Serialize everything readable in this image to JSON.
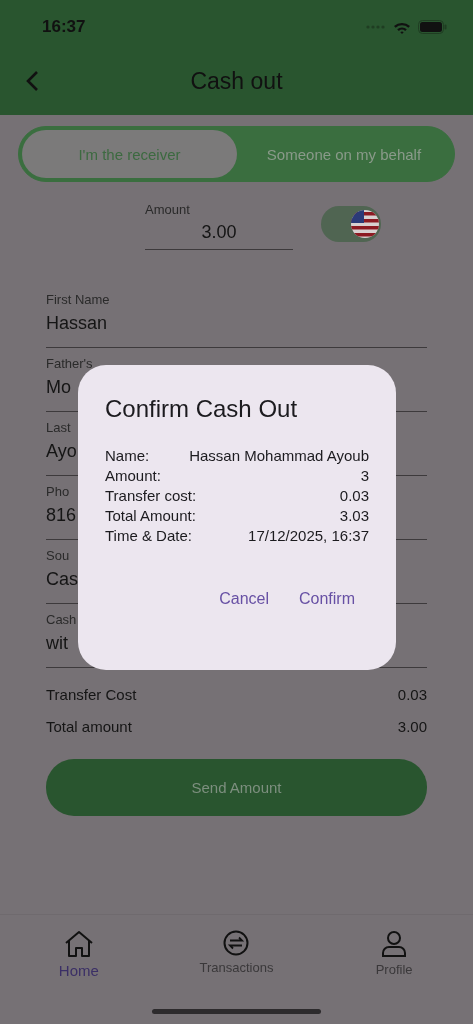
{
  "status_bar": {
    "time": "16:37"
  },
  "header": {
    "title": "Cash out"
  },
  "tabs": [
    {
      "label": "I'm the receiver",
      "selected": true
    },
    {
      "label": "Someone on my behalf",
      "selected": false
    }
  ],
  "amount": {
    "label": "Amount",
    "value": "3.00"
  },
  "currency_toggle": {
    "on": true
  },
  "fields": [
    {
      "label": "First Name",
      "value": "Hassan"
    },
    {
      "label": "Father's",
      "value": "Mo"
    },
    {
      "label": "Last",
      "value": "Ayo"
    },
    {
      "label": "Pho",
      "value": "816"
    },
    {
      "label": "Sou",
      "value": "Cas"
    },
    {
      "label": "Cash",
      "value": "wit"
    }
  ],
  "summary": [
    {
      "label": "Transfer Cost",
      "value": "0.03"
    },
    {
      "label": "Total amount",
      "value": "3.00"
    }
  ],
  "send_button": "Send Amount",
  "dialog": {
    "title": "Confirm Cash Out",
    "rows": [
      {
        "label": "Name:",
        "value": "Hassan Mohammad Ayoub"
      },
      {
        "label": "Amount:",
        "value": "3"
      },
      {
        "label": "Transfer cost:",
        "value": "0.03"
      },
      {
        "label": "Total Amount:",
        "value": "3.03"
      },
      {
        "label": "Time & Date:",
        "value": "17/12/2025, 16:37"
      }
    ],
    "buttons": [
      "Cancel",
      "Confirm"
    ]
  },
  "nav": [
    {
      "label": "Home",
      "selected": true
    },
    {
      "label": "Transactions",
      "selected": false
    },
    {
      "label": "Profile",
      "selected": false
    }
  ]
}
